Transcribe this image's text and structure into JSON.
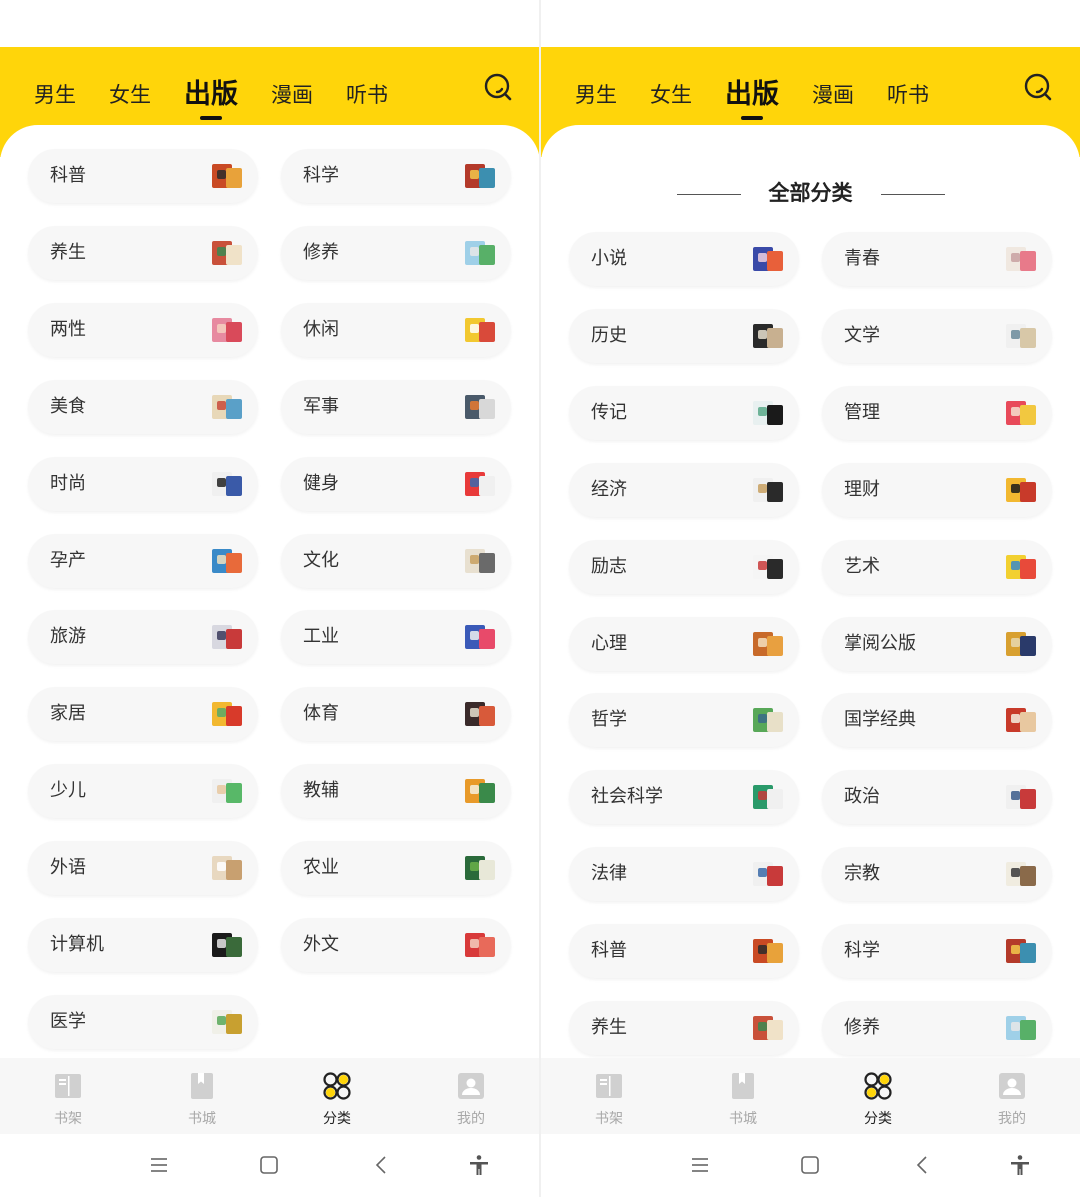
{
  "left": {
    "tabs": [
      "男生",
      "女生",
      "出版",
      "漫画",
      "听书"
    ],
    "active_tab": 2,
    "categories": [
      {
        "label": "科普",
        "c1": "#c94a24",
        "c2": "#e8a23a",
        "c3": "#2b2b2b"
      },
      {
        "label": "科学",
        "c1": "#b43a2a",
        "c2": "#3c8fb0",
        "c3": "#f2c84b"
      },
      {
        "label": "养生",
        "c1": "#c9513a",
        "c2": "#f0e2c8",
        "c3": "#3a8a52"
      },
      {
        "label": "修养",
        "c1": "#9fd0e8",
        "c2": "#58b068",
        "c3": "#e8e8e8"
      },
      {
        "label": "两性",
        "c1": "#e78aa0",
        "c2": "#d94a5a",
        "c3": "#f5d0c0"
      },
      {
        "label": "休闲",
        "c1": "#f2c830",
        "c2": "#d94a3a",
        "c3": "#ffffff"
      },
      {
        "label": "美食",
        "c1": "#e8d8b8",
        "c2": "#5aa0c8",
        "c3": "#c84a3a"
      },
      {
        "label": "军事",
        "c1": "#4a5a6a",
        "c2": "#d8d8d8",
        "c3": "#e87a30"
      },
      {
        "label": "时尚",
        "c1": "#f0f0f0",
        "c2": "#3a5aa8",
        "c3": "#222222"
      },
      {
        "label": "健身",
        "c1": "#e83a3a",
        "c2": "#f0f0f0",
        "c3": "#3a6ab0"
      },
      {
        "label": "孕产",
        "c1": "#3a8ac8",
        "c2": "#e86a3a",
        "c3": "#f0e0c0"
      },
      {
        "label": "文化",
        "c1": "#e8e0d0",
        "c2": "#6a6a6a",
        "c3": "#c8a060"
      },
      {
        "label": "旅游",
        "c1": "#d8d8e0",
        "c2": "#c83a3a",
        "c3": "#3a3a5a"
      },
      {
        "label": "工业",
        "c1": "#3a5ab8",
        "c2": "#e84a6a",
        "c3": "#f0f0f0"
      },
      {
        "label": "家居",
        "c1": "#f2b830",
        "c2": "#d83a2a",
        "c3": "#58a868"
      },
      {
        "label": "体育",
        "c1": "#3a2a2a",
        "c2": "#d85a3a",
        "c3": "#e8e0d0"
      },
      {
        "label": "少儿",
        "c1": "#f0f0f0",
        "c2": "#58b868",
        "c3": "#e8c8a0"
      },
      {
        "label": "教辅",
        "c1": "#e89a2a",
        "c2": "#3a8a4a",
        "c3": "#f5f0e0"
      },
      {
        "label": "外语",
        "c1": "#e8d8c0",
        "c2": "#c8a070",
        "c3": "#ffffff"
      },
      {
        "label": "农业",
        "c1": "#2a6a3a",
        "c2": "#e8e8d8",
        "c3": "#6ab04a"
      },
      {
        "label": "计算机",
        "c1": "#1a1a1a",
        "c2": "#3a6a3a",
        "c3": "#e8e8e8"
      },
      {
        "label": "外文",
        "c1": "#d83a3a",
        "c2": "#e86a5a",
        "c3": "#f5d0c0"
      },
      {
        "label": "医学",
        "c1": "#f0f0e8",
        "c2": "#c8a030",
        "c3": "#58a858"
      }
    ],
    "bottom_nav": [
      {
        "label": "书架",
        "icon": "bookshelf-icon"
      },
      {
        "label": "书城",
        "icon": "bookstore-icon"
      },
      {
        "label": "分类",
        "icon": "category-icon"
      },
      {
        "label": "我的",
        "icon": "profile-icon"
      }
    ],
    "active_nav": 2
  },
  "right": {
    "tabs": [
      "男生",
      "女生",
      "出版",
      "漫画",
      "听书"
    ],
    "active_tab": 2,
    "section_title": "全部分类",
    "categories": [
      {
        "label": "小说",
        "c1": "#3a4aa8",
        "c2": "#e8603a",
        "c3": "#f0d0e0"
      },
      {
        "label": "青春",
        "c1": "#f0e8e0",
        "c2": "#e87a8a",
        "c3": "#c8a0a0"
      },
      {
        "label": "历史",
        "c1": "#2a2a2a",
        "c2": "#c8b090",
        "c3": "#e8e0d0"
      },
      {
        "label": "文学",
        "c1": "#f0f0f0",
        "c2": "#d8c8a8",
        "c3": "#6a8a9a"
      },
      {
        "label": "传记",
        "c1": "#e8f0f0",
        "c2": "#1a1a1a",
        "c3": "#58a888"
      },
      {
        "label": "管理",
        "c1": "#e84a5a",
        "c2": "#f2c840",
        "c3": "#f5e0d0"
      },
      {
        "label": "经济",
        "c1": "#f0f0f0",
        "c2": "#2a2a2a",
        "c3": "#c8a060"
      },
      {
        "label": "理财",
        "c1": "#f2b830",
        "c2": "#c83a2a",
        "c3": "#1a1a1a"
      },
      {
        "label": "励志",
        "c1": "#f5f5f5",
        "c2": "#2a2a2a",
        "c3": "#c83a3a"
      },
      {
        "label": "艺术",
        "c1": "#f2d030",
        "c2": "#e84a3a",
        "c3": "#3a8ac8"
      },
      {
        "label": "心理",
        "c1": "#c86a2a",
        "c2": "#e8a040",
        "c3": "#f5e0c0"
      },
      {
        "label": "掌阅公版",
        "c1": "#d8a030",
        "c2": "#2a3a6a",
        "c3": "#e8d8b0"
      },
      {
        "label": "哲学",
        "c1": "#58a858",
        "c2": "#e8e0c8",
        "c3": "#3a6a8a"
      },
      {
        "label": "国学经典",
        "c1": "#c83a2a",
        "c2": "#e8c8a0",
        "c3": "#f5f0e0"
      },
      {
        "label": "社会科学",
        "c1": "#2a9a6a",
        "c2": "#f0f0f0",
        "c3": "#c83a3a"
      },
      {
        "label": "政治",
        "c1": "#f0f0f0",
        "c2": "#c83a3a",
        "c3": "#3a5a8a"
      },
      {
        "label": "法律",
        "c1": "#f0f0f0",
        "c2": "#c83a3a",
        "c3": "#3a6aa8"
      },
      {
        "label": "宗教",
        "c1": "#f0ece0",
        "c2": "#8a6a4a",
        "c3": "#3a3a3a"
      },
      {
        "label": "科普",
        "c1": "#c94a24",
        "c2": "#e8a23a",
        "c3": "#2b2b2b"
      },
      {
        "label": "科学",
        "c1": "#b43a2a",
        "c2": "#3c8fb0",
        "c3": "#f2c84b"
      },
      {
        "label": "养生",
        "c1": "#c9513a",
        "c2": "#f0e2c8",
        "c3": "#3a8a52"
      },
      {
        "label": "修养",
        "c1": "#9fd0e8",
        "c2": "#58b068",
        "c3": "#e8e8e8"
      }
    ],
    "bottom_nav": [
      {
        "label": "书架",
        "icon": "bookshelf-icon"
      },
      {
        "label": "书城",
        "icon": "bookstore-icon"
      },
      {
        "label": "分类",
        "icon": "category-icon"
      },
      {
        "label": "我的",
        "icon": "profile-icon"
      }
    ],
    "active_nav": 2
  },
  "system_nav": [
    "menu-icon",
    "home-icon",
    "back-icon",
    "accessibility-icon"
  ],
  "colors": {
    "accent": "#ffd50a",
    "pill_bg": "#f7f7f7",
    "nav_inactive": "#a8a8a8"
  }
}
